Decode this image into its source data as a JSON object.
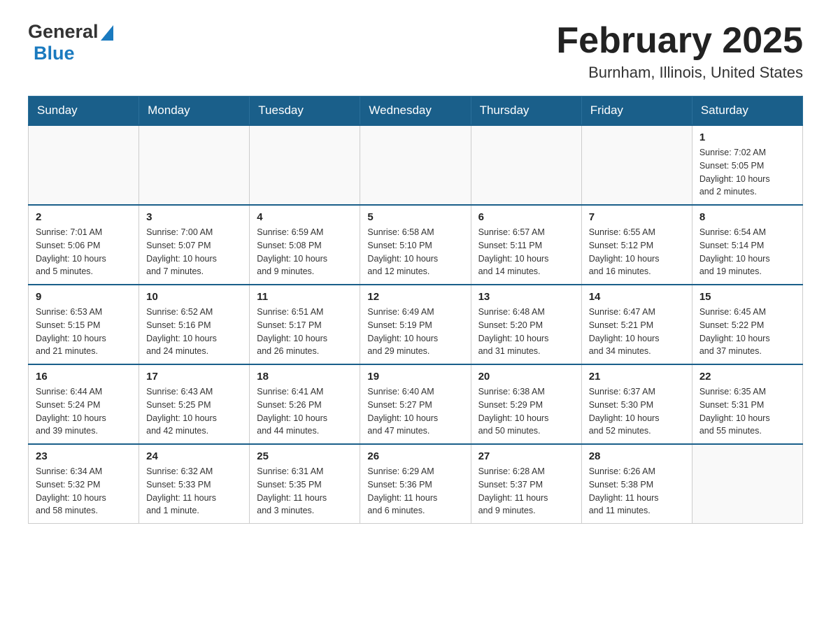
{
  "header": {
    "logo_general": "General",
    "logo_blue": "Blue",
    "month_year": "February 2025",
    "location": "Burnham, Illinois, United States"
  },
  "days_of_week": [
    "Sunday",
    "Monday",
    "Tuesday",
    "Wednesday",
    "Thursday",
    "Friday",
    "Saturday"
  ],
  "weeks": [
    [
      {
        "day": "",
        "info": ""
      },
      {
        "day": "",
        "info": ""
      },
      {
        "day": "",
        "info": ""
      },
      {
        "day": "",
        "info": ""
      },
      {
        "day": "",
        "info": ""
      },
      {
        "day": "",
        "info": ""
      },
      {
        "day": "1",
        "info": "Sunrise: 7:02 AM\nSunset: 5:05 PM\nDaylight: 10 hours\nand 2 minutes."
      }
    ],
    [
      {
        "day": "2",
        "info": "Sunrise: 7:01 AM\nSunset: 5:06 PM\nDaylight: 10 hours\nand 5 minutes."
      },
      {
        "day": "3",
        "info": "Sunrise: 7:00 AM\nSunset: 5:07 PM\nDaylight: 10 hours\nand 7 minutes."
      },
      {
        "day": "4",
        "info": "Sunrise: 6:59 AM\nSunset: 5:08 PM\nDaylight: 10 hours\nand 9 minutes."
      },
      {
        "day": "5",
        "info": "Sunrise: 6:58 AM\nSunset: 5:10 PM\nDaylight: 10 hours\nand 12 minutes."
      },
      {
        "day": "6",
        "info": "Sunrise: 6:57 AM\nSunset: 5:11 PM\nDaylight: 10 hours\nand 14 minutes."
      },
      {
        "day": "7",
        "info": "Sunrise: 6:55 AM\nSunset: 5:12 PM\nDaylight: 10 hours\nand 16 minutes."
      },
      {
        "day": "8",
        "info": "Sunrise: 6:54 AM\nSunset: 5:14 PM\nDaylight: 10 hours\nand 19 minutes."
      }
    ],
    [
      {
        "day": "9",
        "info": "Sunrise: 6:53 AM\nSunset: 5:15 PM\nDaylight: 10 hours\nand 21 minutes."
      },
      {
        "day": "10",
        "info": "Sunrise: 6:52 AM\nSunset: 5:16 PM\nDaylight: 10 hours\nand 24 minutes."
      },
      {
        "day": "11",
        "info": "Sunrise: 6:51 AM\nSunset: 5:17 PM\nDaylight: 10 hours\nand 26 minutes."
      },
      {
        "day": "12",
        "info": "Sunrise: 6:49 AM\nSunset: 5:19 PM\nDaylight: 10 hours\nand 29 minutes."
      },
      {
        "day": "13",
        "info": "Sunrise: 6:48 AM\nSunset: 5:20 PM\nDaylight: 10 hours\nand 31 minutes."
      },
      {
        "day": "14",
        "info": "Sunrise: 6:47 AM\nSunset: 5:21 PM\nDaylight: 10 hours\nand 34 minutes."
      },
      {
        "day": "15",
        "info": "Sunrise: 6:45 AM\nSunset: 5:22 PM\nDaylight: 10 hours\nand 37 minutes."
      }
    ],
    [
      {
        "day": "16",
        "info": "Sunrise: 6:44 AM\nSunset: 5:24 PM\nDaylight: 10 hours\nand 39 minutes."
      },
      {
        "day": "17",
        "info": "Sunrise: 6:43 AM\nSunset: 5:25 PM\nDaylight: 10 hours\nand 42 minutes."
      },
      {
        "day": "18",
        "info": "Sunrise: 6:41 AM\nSunset: 5:26 PM\nDaylight: 10 hours\nand 44 minutes."
      },
      {
        "day": "19",
        "info": "Sunrise: 6:40 AM\nSunset: 5:27 PM\nDaylight: 10 hours\nand 47 minutes."
      },
      {
        "day": "20",
        "info": "Sunrise: 6:38 AM\nSunset: 5:29 PM\nDaylight: 10 hours\nand 50 minutes."
      },
      {
        "day": "21",
        "info": "Sunrise: 6:37 AM\nSunset: 5:30 PM\nDaylight: 10 hours\nand 52 minutes."
      },
      {
        "day": "22",
        "info": "Sunrise: 6:35 AM\nSunset: 5:31 PM\nDaylight: 10 hours\nand 55 minutes."
      }
    ],
    [
      {
        "day": "23",
        "info": "Sunrise: 6:34 AM\nSunset: 5:32 PM\nDaylight: 10 hours\nand 58 minutes."
      },
      {
        "day": "24",
        "info": "Sunrise: 6:32 AM\nSunset: 5:33 PM\nDaylight: 11 hours\nand 1 minute."
      },
      {
        "day": "25",
        "info": "Sunrise: 6:31 AM\nSunset: 5:35 PM\nDaylight: 11 hours\nand 3 minutes."
      },
      {
        "day": "26",
        "info": "Sunrise: 6:29 AM\nSunset: 5:36 PM\nDaylight: 11 hours\nand 6 minutes."
      },
      {
        "day": "27",
        "info": "Sunrise: 6:28 AM\nSunset: 5:37 PM\nDaylight: 11 hours\nand 9 minutes."
      },
      {
        "day": "28",
        "info": "Sunrise: 6:26 AM\nSunset: 5:38 PM\nDaylight: 11 hours\nand 11 minutes."
      },
      {
        "day": "",
        "info": ""
      }
    ]
  ]
}
